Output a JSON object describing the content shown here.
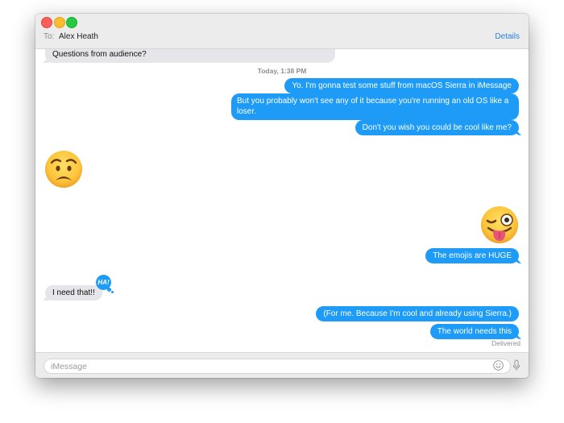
{
  "window": {
    "to_label": "To:",
    "recipient": "Alex Heath",
    "details_label": "Details"
  },
  "conversation": {
    "timestamp_day": "Today,",
    "timestamp_time": "1:38 PM",
    "messages": [
      {
        "direction": "incoming",
        "text": "Questions from audience?"
      },
      {
        "direction": "outgoing",
        "text": "Yo. I'm gonna test some stuff from macOS Sierra in iMessage"
      },
      {
        "direction": "outgoing",
        "text": "But you probably won't see any of it because you're running an old OS like a loser."
      },
      {
        "direction": "outgoing",
        "text": "Don't you wish you could be cool like me?"
      },
      {
        "direction": "incoming",
        "emoji": "worried-face"
      },
      {
        "direction": "outgoing",
        "emoji": "winking-face-with-tongue"
      },
      {
        "direction": "outgoing",
        "text": "The emojis are HUGE"
      },
      {
        "direction": "incoming",
        "text": "I need that!!",
        "tapback": "HA!"
      },
      {
        "direction": "outgoing",
        "text": "(For me. Because I'm cool and already using Sierra.)"
      },
      {
        "direction": "outgoing",
        "text": "The world needs this"
      }
    ],
    "status": "Delivered"
  },
  "input": {
    "placeholder": "iMessage",
    "value": ""
  },
  "colors": {
    "outgoing_bubble": "#1d9bf6",
    "incoming_bubble": "#e5e5ea",
    "link": "#2d7fde"
  }
}
